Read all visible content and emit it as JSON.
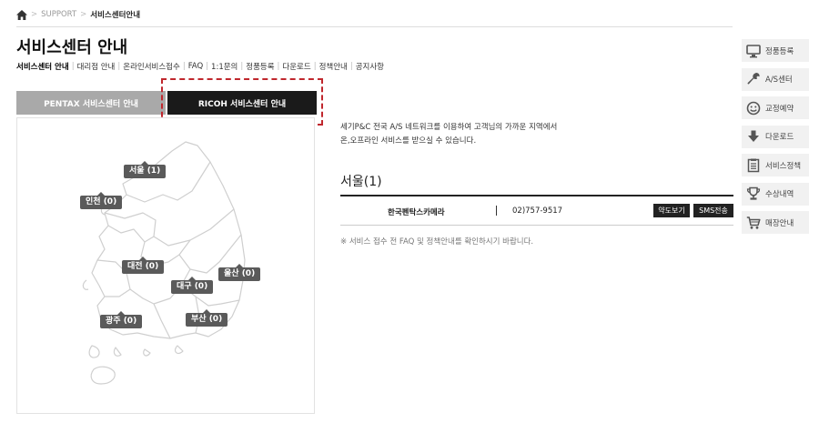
{
  "breadcrumb": {
    "section": "SUPPORT",
    "sep": ">",
    "current": "서비스센터안내"
  },
  "page": {
    "title": "서비스센터 안내"
  },
  "subnav": [
    {
      "label": "서비스센터 안내",
      "active": true
    },
    {
      "label": "대리점 안내"
    },
    {
      "label": "온라인서비스접수"
    },
    {
      "label": "FAQ"
    },
    {
      "label": "1:1문의"
    },
    {
      "label": "정품등록"
    },
    {
      "label": "다운로드"
    },
    {
      "label": "정책안내"
    },
    {
      "label": "공지사항"
    }
  ],
  "subnav_divider": "|",
  "tabs": {
    "pentax": "PENTAX 서비스센터 안내",
    "ricoh": "RICOH 서비스센터 안내"
  },
  "map": {
    "regions": {
      "seoul": "서울 (1)",
      "incheon": "인천 (0)",
      "daejeon": "대전 (0)",
      "ulsan": "울산 (0)",
      "daegu": "대구 (0)",
      "gwangju": "광주 (0)",
      "busan": "부산 (0)"
    }
  },
  "intro": {
    "line1": "세기P&C 전국 A/S 네트워크를 이용하여 고객님의 가까운 지역에서",
    "line2": "온,오프라인 서비스를 받으실 수 있습니다."
  },
  "selected_region": "서울(1)",
  "centers": [
    {
      "name": "한국펜탁스카메라",
      "separator": "I",
      "phone": "02)757-9517",
      "map_label": "약도보기",
      "sms_label": "SMS전송"
    }
  ],
  "notice": "※ 서비스 접수 전 FAQ 및 정책안내를 확인하시기 바랍니다.",
  "quick_menu": [
    {
      "label": "정품등록",
      "icon": "monitor-icon"
    },
    {
      "label": "A/S센터",
      "icon": "wrench-icon"
    },
    {
      "label": "교정예약",
      "icon": "smile-icon"
    },
    {
      "label": "다운로드",
      "icon": "download-arrow-icon"
    },
    {
      "label": "서비스정책",
      "icon": "document-icon"
    },
    {
      "label": "수상내역",
      "icon": "trophy-icon"
    },
    {
      "label": "매장안내",
      "icon": "cart-icon"
    }
  ],
  "colors": {
    "accent_dashed": "#c0272d",
    "tab_active": "#1a1a1a",
    "tab_inactive": "#a9a9a9",
    "region_label": "#5a5a5a"
  }
}
